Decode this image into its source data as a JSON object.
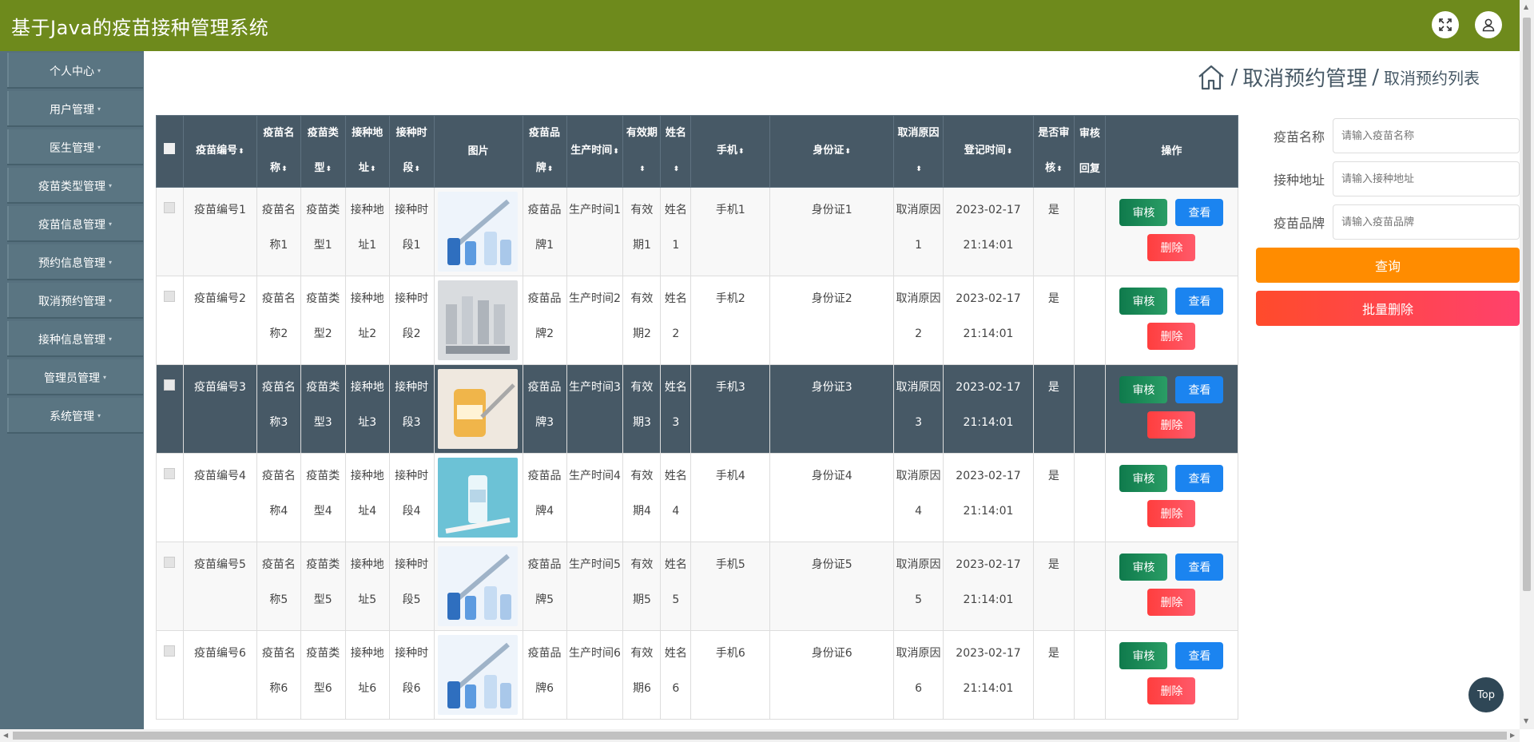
{
  "header": {
    "title": "基于Java的疫苗接种管理系统",
    "fullscreen_icon": "expand-icon",
    "user_icon": "user-icon"
  },
  "sidebar": {
    "items": [
      {
        "label": "个人中心"
      },
      {
        "label": "用户管理"
      },
      {
        "label": "医生管理"
      },
      {
        "label": "疫苗类型管理"
      },
      {
        "label": "疫苗信息管理"
      },
      {
        "label": "预约信息管理"
      },
      {
        "label": "取消预约管理"
      },
      {
        "label": "接种信息管理"
      },
      {
        "label": "管理员管理"
      },
      {
        "label": "系统管理"
      }
    ],
    "caret": "▾"
  },
  "breadcrumb": {
    "sep": "/",
    "main": "取消预约管理",
    "sub": "取消预约列表"
  },
  "table": {
    "headers": {
      "code": "疫苗编号",
      "name": "疫苗名称",
      "type": "疫苗类型",
      "addr": "接种地址",
      "slot": "接种时段",
      "image": "图片",
      "brand": "疫苗品牌",
      "produced": "生产时间",
      "valid": "有效期",
      "pname": "姓名",
      "phone": "手机",
      "idcard": "身份证",
      "reason": "取消原因",
      "regtime": "登记时间",
      "audited": "是否审核",
      "reply": "审核回复",
      "ops": "操作"
    },
    "sort_icon": "⬍",
    "buttons": {
      "audit": "审核",
      "view": "查看",
      "delete": "删除"
    },
    "rows": [
      {
        "code": "疫苗编号1",
        "name": "疫苗名称1",
        "type": "疫苗类型1",
        "addr": "接种地址1",
        "slot": "接种时段1",
        "brand": "疫苗品牌1",
        "produced": "生产时间1",
        "valid": "有效期1",
        "pname": "姓名1",
        "phone": "手机1",
        "idcard": "身份证1",
        "reason": "取消原因1",
        "date": "2023-02-17",
        "time": "21:14:01",
        "audited": "是",
        "reply": ""
      },
      {
        "code": "疫苗编号2",
        "name": "疫苗名称2",
        "type": "疫苗类型2",
        "addr": "接种地址2",
        "slot": "接种时段2",
        "brand": "疫苗品牌2",
        "produced": "生产时间2",
        "valid": "有效期2",
        "pname": "姓名2",
        "phone": "手机2",
        "idcard": "身份证2",
        "reason": "取消原因2",
        "date": "2023-02-17",
        "time": "21:14:01",
        "audited": "是",
        "reply": ""
      },
      {
        "code": "疫苗编号3",
        "name": "疫苗名称3",
        "type": "疫苗类型3",
        "addr": "接种地址3",
        "slot": "接种时段3",
        "brand": "疫苗品牌3",
        "produced": "生产时间3",
        "valid": "有效期3",
        "pname": "姓名3",
        "phone": "手机3",
        "idcard": "身份证3",
        "reason": "取消原因3",
        "date": "2023-02-17",
        "time": "21:14:01",
        "audited": "是",
        "reply": ""
      },
      {
        "code": "疫苗编号4",
        "name": "疫苗名称4",
        "type": "疫苗类型4",
        "addr": "接种地址4",
        "slot": "接种时段4",
        "brand": "疫苗品牌4",
        "produced": "生产时间4",
        "valid": "有效期4",
        "pname": "姓名4",
        "phone": "手机4",
        "idcard": "身份证4",
        "reason": "取消原因4",
        "date": "2023-02-17",
        "time": "21:14:01",
        "audited": "是",
        "reply": ""
      },
      {
        "code": "疫苗编号5",
        "name": "疫苗名称5",
        "type": "疫苗类型5",
        "addr": "接种地址5",
        "slot": "接种时段5",
        "brand": "疫苗品牌5",
        "produced": "生产时间5",
        "valid": "有效期5",
        "pname": "姓名5",
        "phone": "手机5",
        "idcard": "身份证5",
        "reason": "取消原因5",
        "date": "2023-02-17",
        "time": "21:14:01",
        "audited": "是",
        "reply": ""
      },
      {
        "code": "疫苗编号6",
        "name": "疫苗名称6",
        "type": "疫苗类型6",
        "addr": "接种地址6",
        "slot": "接种时段6",
        "brand": "疫苗品牌6",
        "produced": "生产时间6",
        "valid": "有效期6",
        "pname": "姓名6",
        "phone": "手机6",
        "idcard": "身份证6",
        "reason": "取消原因6",
        "date": "2023-02-17",
        "time": "21:14:01",
        "audited": "是",
        "reply": ""
      }
    ]
  },
  "search": {
    "fields": [
      {
        "label": "疫苗名称",
        "placeholder": "请输入疫苗名称"
      },
      {
        "label": "接种地址",
        "placeholder": "请输入接种地址"
      },
      {
        "label": "疫苗品牌",
        "placeholder": "请输入疫苗品牌"
      }
    ],
    "query_label": "查询",
    "batch_delete_label": "批量删除"
  },
  "top_button": "Top",
  "colors": {
    "header": "#6e8a1c",
    "sidebar": "#56707e",
    "table_head": "#475966",
    "query": "#ff8c00"
  }
}
